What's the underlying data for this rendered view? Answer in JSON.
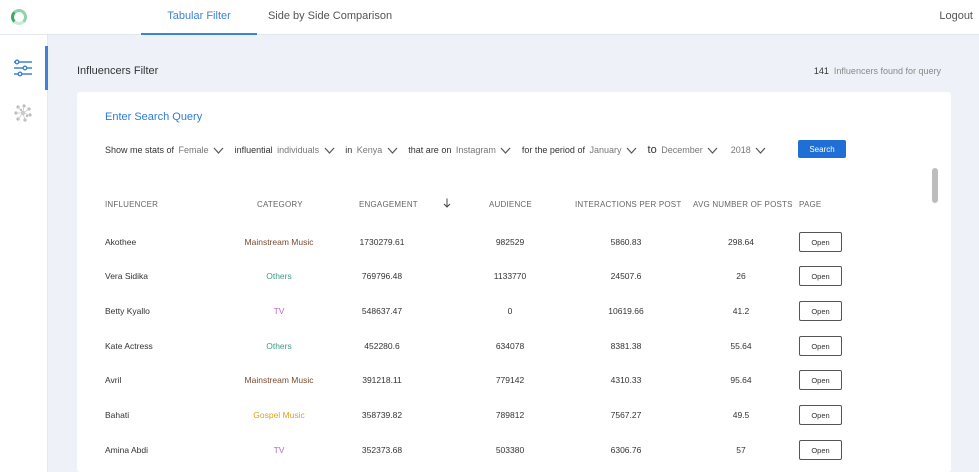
{
  "nav": {
    "tabs": [
      {
        "label": "Tabular Filter",
        "active": true
      },
      {
        "label": "Side by Side Comparison",
        "active": false
      }
    ],
    "logout_label": "Logout"
  },
  "page": {
    "title": "Influencers Filter",
    "found_count": "141",
    "found_label": "Influencers found for query"
  },
  "query": {
    "title": "Enter Search Query",
    "filters": [
      {
        "prefix": "Show me stats of",
        "value": "Female"
      },
      {
        "prefix": "influential",
        "value": "individuals"
      },
      {
        "prefix": "in",
        "value": "Kenya"
      },
      {
        "prefix": "that are on",
        "value": "Instagram"
      },
      {
        "prefix": "for the period of",
        "value": "January"
      },
      {
        "prefix": "to",
        "value": "December"
      },
      {
        "prefix": "",
        "value": "2018"
      }
    ],
    "search_label": "Search"
  },
  "table": {
    "headers": {
      "influencer": "INFLUENCER",
      "category": "CATEGORY",
      "engagement": "ENGAGEMENT",
      "audience": "AUDIENCE",
      "interactions": "INTERACTIONS PER POST",
      "avg_posts": "AVG NUMBER OF POSTS",
      "page": "PAGE"
    },
    "open_label": "Open",
    "rows": [
      {
        "name": "Akothee",
        "category": "Mainstream Music",
        "cat_color": "#7a4a2e",
        "engagement": "1730279.61",
        "audience": "982529",
        "interactions": "5860.83",
        "avg_posts": "298.64"
      },
      {
        "name": "Vera Sidika",
        "category": "Others",
        "cat_color": "#3d9a8a",
        "engagement": "769796.48",
        "audience": "1133770",
        "interactions": "24507.6",
        "avg_posts": "26"
      },
      {
        "name": "Betty Kyallo",
        "category": "TV",
        "cat_color": "#c06ac0",
        "engagement": "548637.47",
        "audience": "0",
        "interactions": "10619.66",
        "avg_posts": "41.2"
      },
      {
        "name": "Kate Actress",
        "category": "Others",
        "cat_color": "#3d9a8a",
        "engagement": "452280.6",
        "audience": "634078",
        "interactions": "8381.38",
        "avg_posts": "55.64"
      },
      {
        "name": "Avril",
        "category": "Mainstream Music",
        "cat_color": "#7a4a2e",
        "engagement": "391218.11",
        "audience": "779142",
        "interactions": "4310.33",
        "avg_posts": "95.64"
      },
      {
        "name": "Bahati",
        "category": "Gospel Music",
        "cat_color": "#e0a020",
        "engagement": "358739.82",
        "audience": "789812",
        "interactions": "7567.27",
        "avg_posts": "49.5"
      },
      {
        "name": "Amina Abdi",
        "category": "TV",
        "cat_color": "#c06ac0",
        "engagement": "352373.68",
        "audience": "503380",
        "interactions": "6306.76",
        "avg_posts": "57"
      }
    ]
  }
}
